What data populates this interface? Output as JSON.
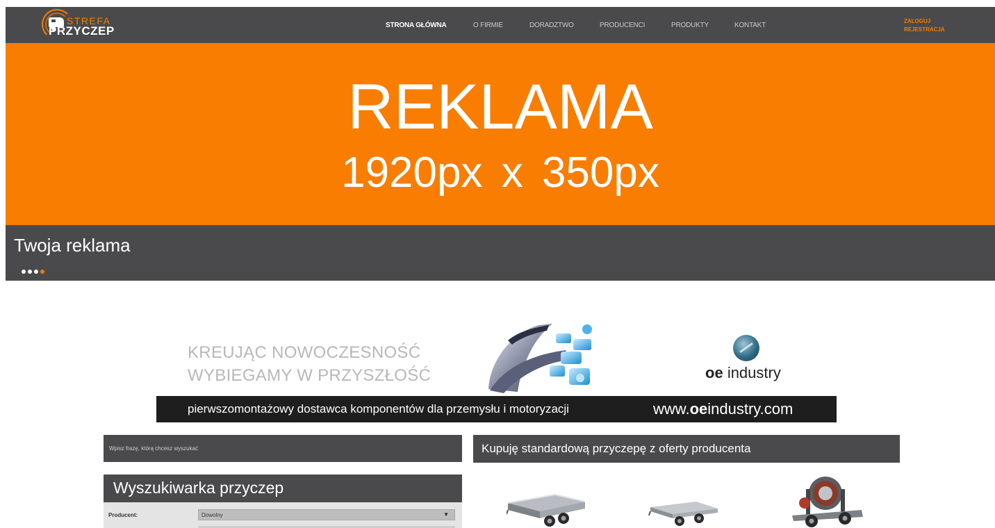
{
  "header": {
    "logo_top": "STREFA",
    "logo_bottom": "PRZYCZEP",
    "nav": [
      {
        "label": "STRONA GŁÓWNA",
        "active": true
      },
      {
        "label": "O FIRMIE",
        "active": false
      },
      {
        "label": "DORADZTWO",
        "active": false
      },
      {
        "label": "PRODUCENCI",
        "active": false
      },
      {
        "label": "PRODUKTY",
        "active": false
      },
      {
        "label": "KONTAKT",
        "active": false
      }
    ],
    "login": "ZALOGUJ",
    "register": "REJESTRACJA"
  },
  "banner": {
    "line1": "REKLAMA",
    "line2": "1920px  x  350px",
    "bg_color": "#f97d00"
  },
  "slider": {
    "caption": "Twoja reklama",
    "dot_count": 4,
    "active_dot": 4
  },
  "ad": {
    "slogan_line1": "KREUJĄC NOWOCZESNOŚĆ",
    "slogan_line2": "WYBIEGAMY W PRZYSZŁOŚĆ",
    "logo_bold": "oe",
    "logo_rest": "industry",
    "strip_text": "pierwszomontażowy dostawca komponentów dla przemysłu i motoryzacji",
    "url_prefix": "www.",
    "url_bold": "oe",
    "url_suffix": "industry.com"
  },
  "search": {
    "placeholder": "Wpisz frazę, którą chcesz wyszukać"
  },
  "finder": {
    "title": "Wyszukiwarka przyczep",
    "producer_label": "Producent:",
    "producer_value": "Dowolny"
  },
  "offer": {
    "title": "Kupuję standardową przyczepę z oferty producenta"
  },
  "colors": {
    "accent": "#f57d00",
    "dark": "#4a4a4c"
  }
}
